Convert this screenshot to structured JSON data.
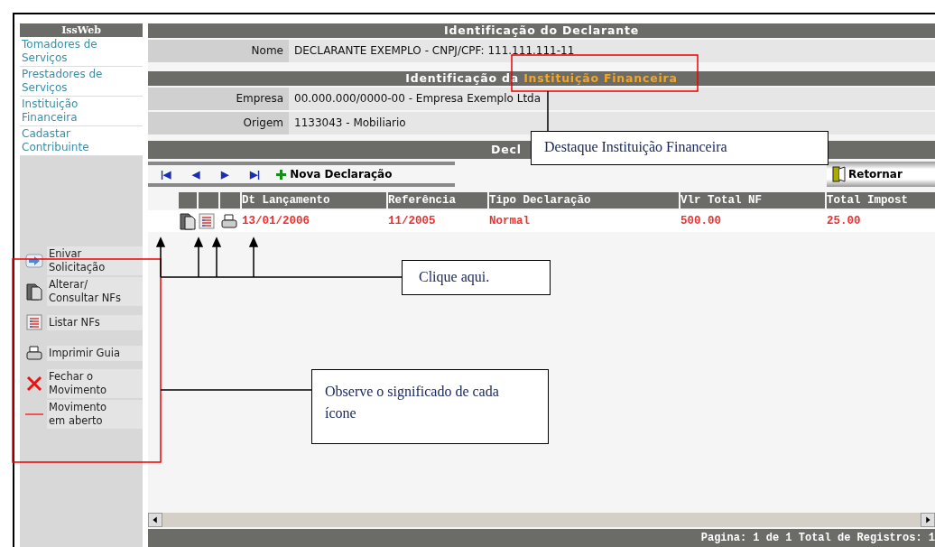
{
  "sidebar": {
    "title": "IssWeb",
    "items": [
      {
        "label": "Tomadores de Serviços"
      },
      {
        "label": "Prestadores de Serviços"
      },
      {
        "label": "Instituição Financeira"
      },
      {
        "label": "Cadastar Contribuinte"
      }
    ],
    "legend": [
      {
        "kind": "send",
        "label": "Enivar\nSolicitação"
      },
      {
        "kind": "edit",
        "label": "Alterar/\nConsultar NFs"
      },
      {
        "kind": "list",
        "label": "Listar NFs"
      },
      {
        "kind": "print",
        "label": "Imprimir Guia"
      },
      {
        "kind": "close",
        "label": "Fechar o\nMovimento"
      },
      {
        "kind": "open",
        "label": "Movimento\nem aberto"
      }
    ]
  },
  "declarante": {
    "title": "Identificação do Declarante",
    "fields": [
      {
        "label": "Nome",
        "value": "DECLARANTE EXEMPLO - CNPJ/CPF: 111.111.111-11"
      }
    ]
  },
  "instituicao": {
    "title": "Identificação da **Instituição Financeira**",
    "fields": [
      {
        "label": "Empresa",
        "value": "00.000.000/0000-00 - Empresa Exemplo Ltda"
      },
      {
        "label": "Origem",
        "value": "1133043 - Mobiliario"
      }
    ]
  },
  "declaracoes": {
    "title": "Decl",
    "toolbar": {
      "nav": [
        "|◀",
        "◀",
        "▶",
        "▶|"
      ],
      "new_button": "Nova Declaração",
      "back_button": "Retornar"
    },
    "columns": [
      "Dt Lançamento",
      "Referência",
      "Tipo Declaração",
      "Vlr Total NF",
      "Total Impost"
    ],
    "rows": [
      {
        "cells": [
          "13/01/2006",
          "11/2005",
          "Normal",
          "500.00",
          "25.00"
        ]
      }
    ],
    "footer": "Pagina: 1 de 1 Total de Registros: 1"
  },
  "annotations": [
    {
      "text": "Destaque Instituição Financeira"
    },
    {
      "text": "Clique aqui."
    },
    {
      "text": "Observe o significado de cada ícone"
    }
  ]
}
